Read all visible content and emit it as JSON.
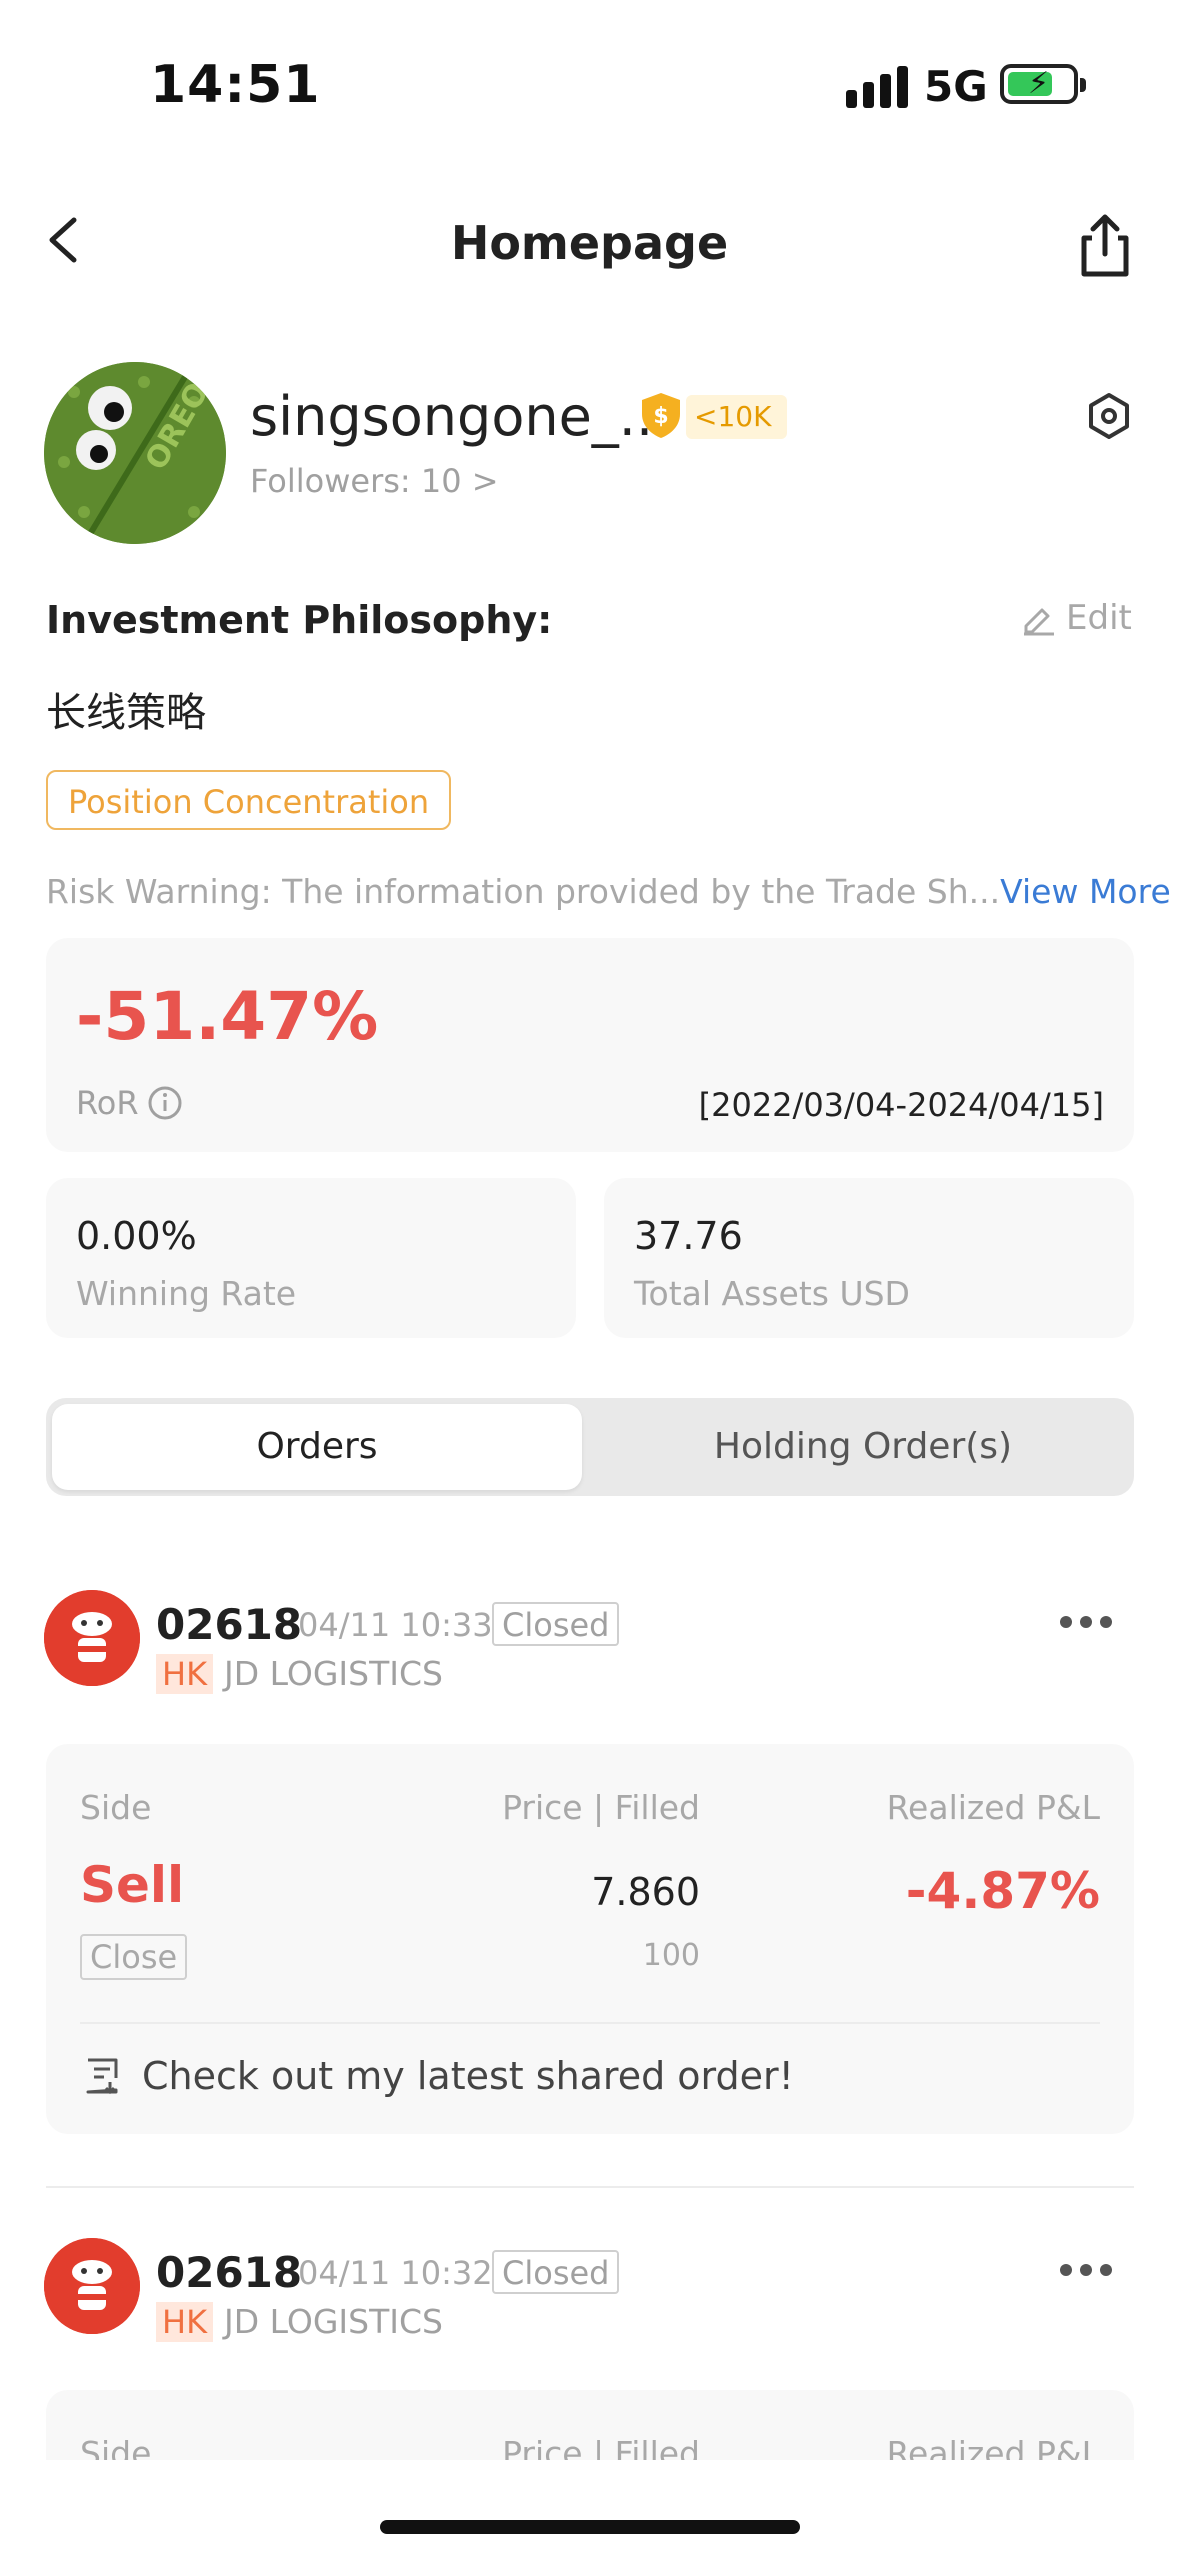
{
  "status_bar": {
    "time": "14:51",
    "network": "5G"
  },
  "nav": {
    "title": "Homepage"
  },
  "profile": {
    "username": "singsongone_...",
    "level_badge": "<10K",
    "followers": "Followers: 10 >",
    "avatar_text": "OREO"
  },
  "philosophy": {
    "title": "Investment Philosophy:",
    "edit_label": "Edit",
    "text": "长线策略",
    "tag": "Position Concentration"
  },
  "risk": {
    "text": "Risk Warning: The information provided by the Trade Sh...",
    "view_more": "View More"
  },
  "ror": {
    "value": "-51.47%",
    "label": "RoR",
    "range": "[2022/03/04-2024/04/15]"
  },
  "stats": {
    "winning_rate": {
      "value": "0.00%",
      "label": "Winning Rate"
    },
    "total_assets": {
      "value": "37.76",
      "label": "Total Assets USD"
    }
  },
  "tabs": {
    "orders": "Orders",
    "holding": "Holding Order(s)",
    "active": "Orders"
  },
  "orders": [
    {
      "code": "02618",
      "time": "04/11 10:33",
      "status": "Closed",
      "market": "HK",
      "name": "JD LOGISTICS",
      "head_side": "Side",
      "head_price": "Price | Filled",
      "head_pnl": "Realized P&L",
      "side": "Sell",
      "close": "Close",
      "price": "7.860",
      "filled": "100",
      "pnl": "-4.87%",
      "share_text": "Check out my latest shared order!"
    },
    {
      "code": "02618",
      "time": "04/11 10:32",
      "status": "Closed",
      "market": "HK",
      "name": "JD LOGISTICS",
      "head_side": "Side",
      "head_price": "Price | Filled",
      "head_pnl": "Realized P&L"
    }
  ],
  "colors": {
    "loss_red": "#e8544e",
    "accent_orange": "#eea33a",
    "link_blue": "#3a7bd5",
    "avatar_red": "#e23d2d"
  }
}
